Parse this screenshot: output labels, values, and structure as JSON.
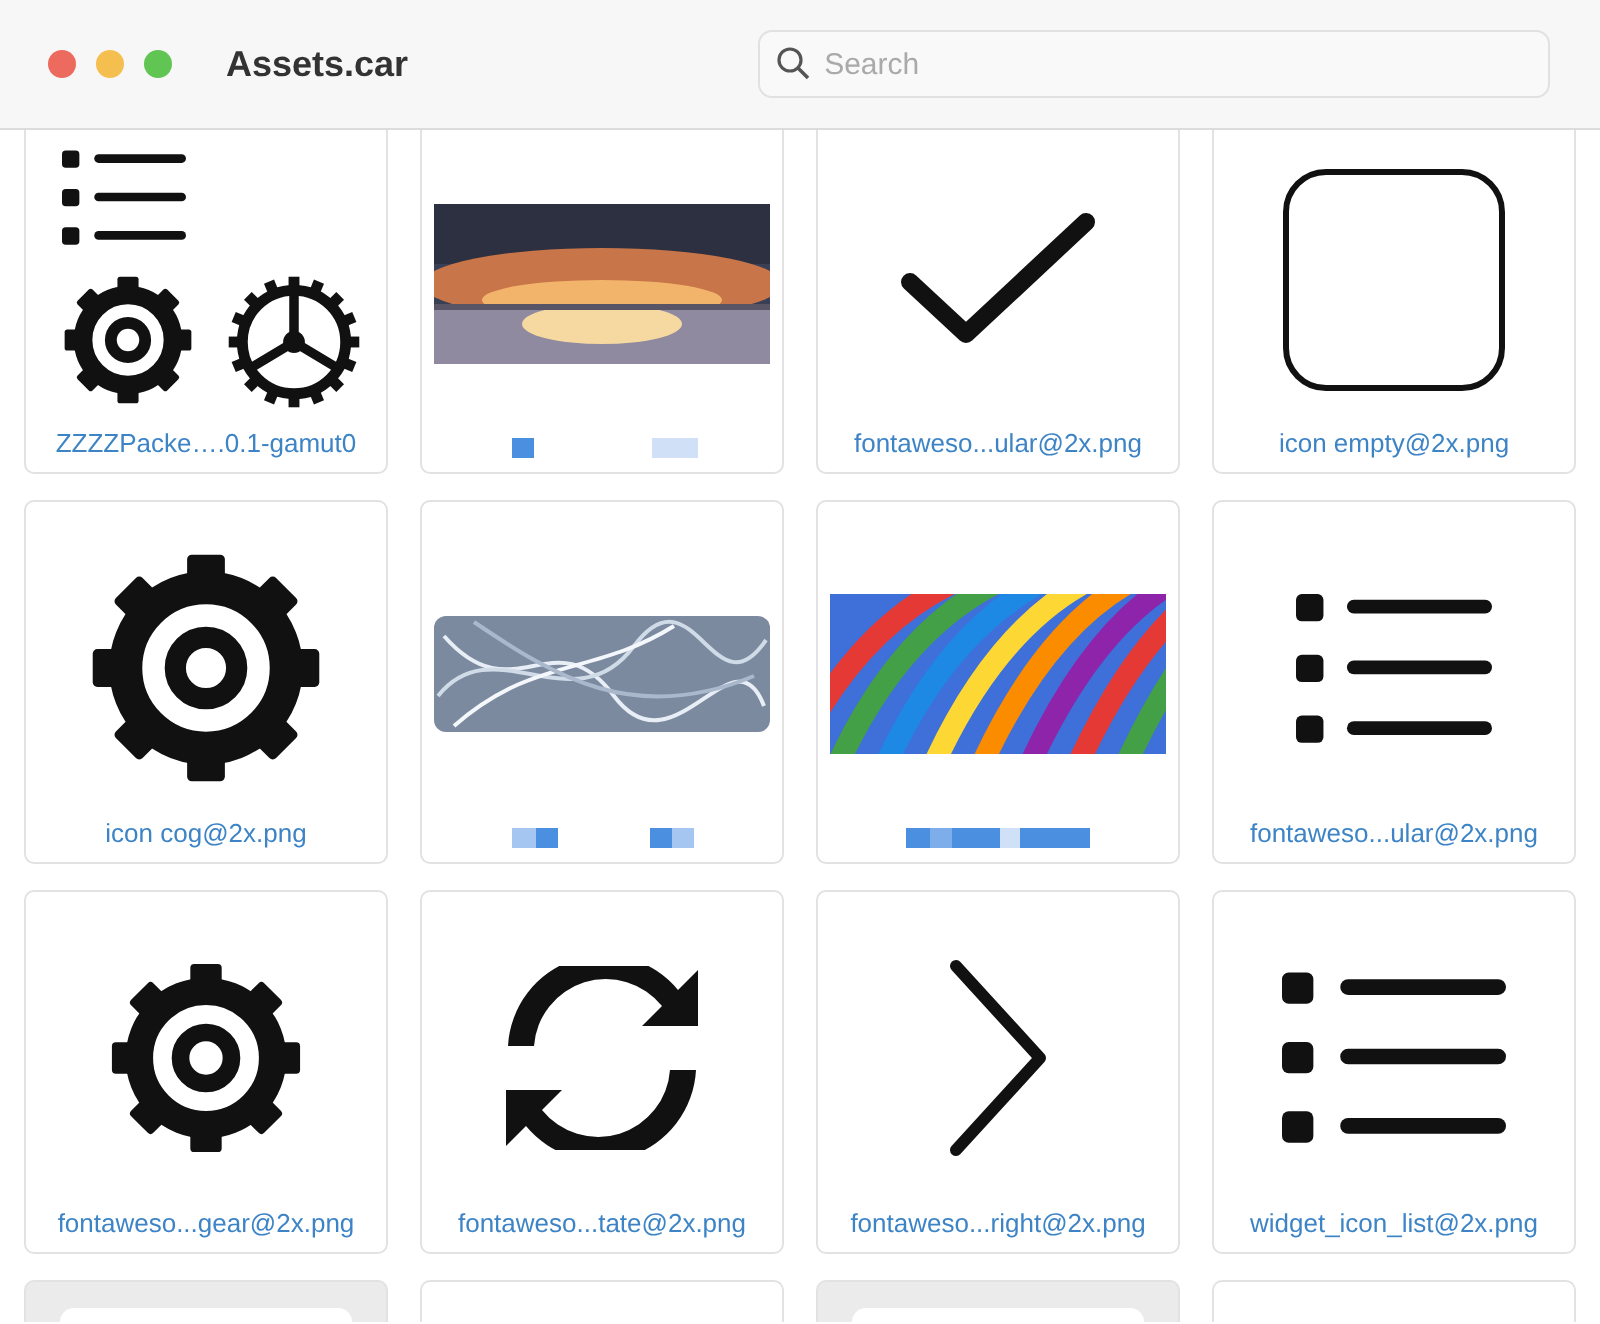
{
  "window": {
    "title": "Assets.car"
  },
  "search": {
    "placeholder": "Search"
  },
  "cards": [
    {
      "kind": "listgears",
      "label": "ZZZZPacke….0.1-gamut0"
    },
    {
      "kind": "sunset"
    },
    {
      "kind": "check",
      "label": "fontaweso...ular@2x.png"
    },
    {
      "kind": "square",
      "label": "icon empty@2x.png"
    },
    {
      "kind": "cog",
      "label": "icon cog@2x.png"
    },
    {
      "kind": "scribble"
    },
    {
      "kind": "colorful"
    },
    {
      "kind": "list",
      "label": "fontaweso...ular@2x.png"
    },
    {
      "kind": "gear",
      "label": "fontaweso...gear@2x.png"
    },
    {
      "kind": "refresh",
      "label": "fontaweso...tate@2x.png"
    },
    {
      "kind": "chevron",
      "label": "fontaweso...right@2x.png"
    },
    {
      "kind": "listwide",
      "label": "widget_icon_list@2x.png"
    },
    {
      "kind": "greythumb"
    },
    {
      "kind": "blank"
    },
    {
      "kind": "greythumb"
    },
    {
      "kind": "blank"
    }
  ]
}
